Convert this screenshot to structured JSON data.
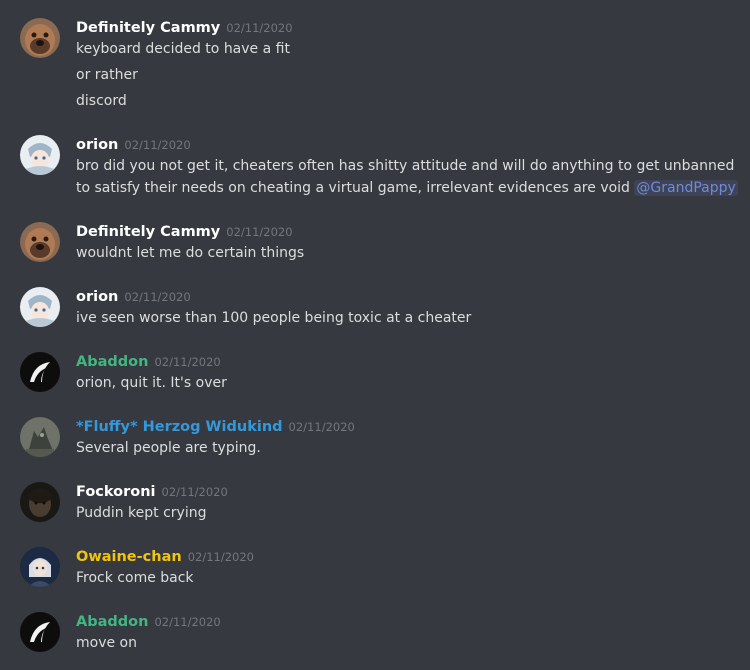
{
  "messages": [
    {
      "author": "Definitely Cammy",
      "timestamp": "02/11/2020",
      "lines": [
        "keyboard decided to have a fit",
        "or rather",
        "discord"
      ]
    },
    {
      "author": "orion",
      "timestamp": "02/11/2020",
      "lines": [
        "bro did you not get it, cheaters often has shitty attitude and will do anything to get unbanned",
        "to satisfy their needs on cheating a virtual game, irrelevant evidences are void"
      ],
      "mention": "@GrandPappy"
    },
    {
      "author": "Definitely Cammy",
      "timestamp": "02/11/2020",
      "lines": [
        "wouldnt let me do certain things"
      ]
    },
    {
      "author": "orion",
      "timestamp": "02/11/2020",
      "lines": [
        "ive seen worse than 100 people being toxic at a cheater"
      ]
    },
    {
      "author": "Abaddon",
      "timestamp": "02/11/2020",
      "lines": [
        "orion, quit it. It's over"
      ]
    },
    {
      "author": "*Fluffy* Herzog Widukind",
      "timestamp": "02/11/2020",
      "lines": [
        "Several people are typing."
      ]
    },
    {
      "author": "Fockoroni",
      "timestamp": "02/11/2020",
      "lines": [
        "Puddin kept crying"
      ]
    },
    {
      "author": "Owaine-chan",
      "timestamp": "02/11/2020",
      "lines": [
        "Frock come back"
      ]
    },
    {
      "author": "Abaddon",
      "timestamp": "02/11/2020",
      "lines": [
        "move on"
      ]
    }
  ],
  "colors": {
    "background": "#36393f",
    "text": "#dcddde",
    "timestamp": "#72767d",
    "username_default": "#ffffff",
    "username_green": "#43b581",
    "username_blue": "#3498db",
    "username_gold": "#f1c40f",
    "mention": "#7289da"
  },
  "avatars": [
    "mastiff-dog-avatar",
    "anime-character-avatar",
    "mastiff-dog-avatar",
    "anime-character-avatar",
    "black-hood-avatar",
    "wolf-statue-avatar",
    "dark-face-avatar",
    "anime-girl-avatar",
    "black-hood-avatar"
  ]
}
